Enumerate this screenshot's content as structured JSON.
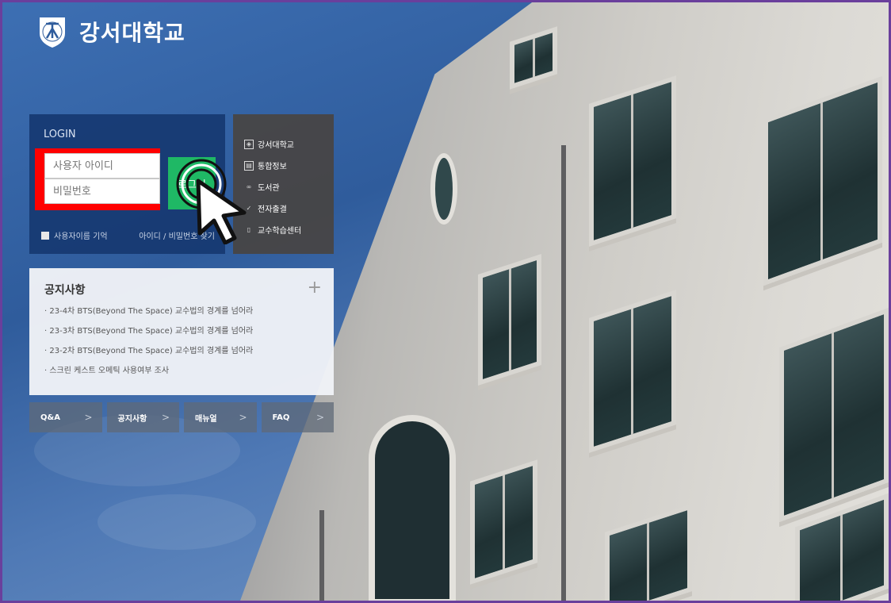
{
  "header": {
    "logo_text": "강서대학교"
  },
  "login": {
    "title": "LOGIN",
    "id_placeholder": "사용자 아이디",
    "pw_placeholder": "비밀번호",
    "submit_label": "로그인",
    "remember_label": "사용자이름 기억",
    "find_label": "아이디 / 비밀번호 찾기"
  },
  "quick_menu": {
    "items": [
      {
        "label": "강서대학교",
        "icon": "school-icon"
      },
      {
        "label": "통합정보",
        "icon": "document-icon"
      },
      {
        "label": "도서관",
        "icon": "link-icon"
      },
      {
        "label": "전자출결",
        "icon": "check-icon"
      },
      {
        "label": "교수학습센터",
        "icon": "book-icon"
      }
    ]
  },
  "notice": {
    "title": "공지사항",
    "items": [
      "23-4차 BTS(Beyond The Space) 교수법의 경계를 넘어라",
      "23-3차 BTS(Beyond The Space) 교수법의 경계를 넘어라",
      "23-2차 BTS(Beyond The Space) 교수법의 경계를 넘어라",
      "스크린 케스트 오메틱 사용여부 조사"
    ]
  },
  "bottom_buttons": [
    {
      "label": "Q&A"
    },
    {
      "label": "공지사항"
    },
    {
      "label": "매뉴얼"
    },
    {
      "label": "FAQ"
    }
  ],
  "colors": {
    "login_panel": "#14376e",
    "login_button": "#1fb865",
    "highlight": "#ff0000",
    "frame_border": "#6a3f9c"
  }
}
